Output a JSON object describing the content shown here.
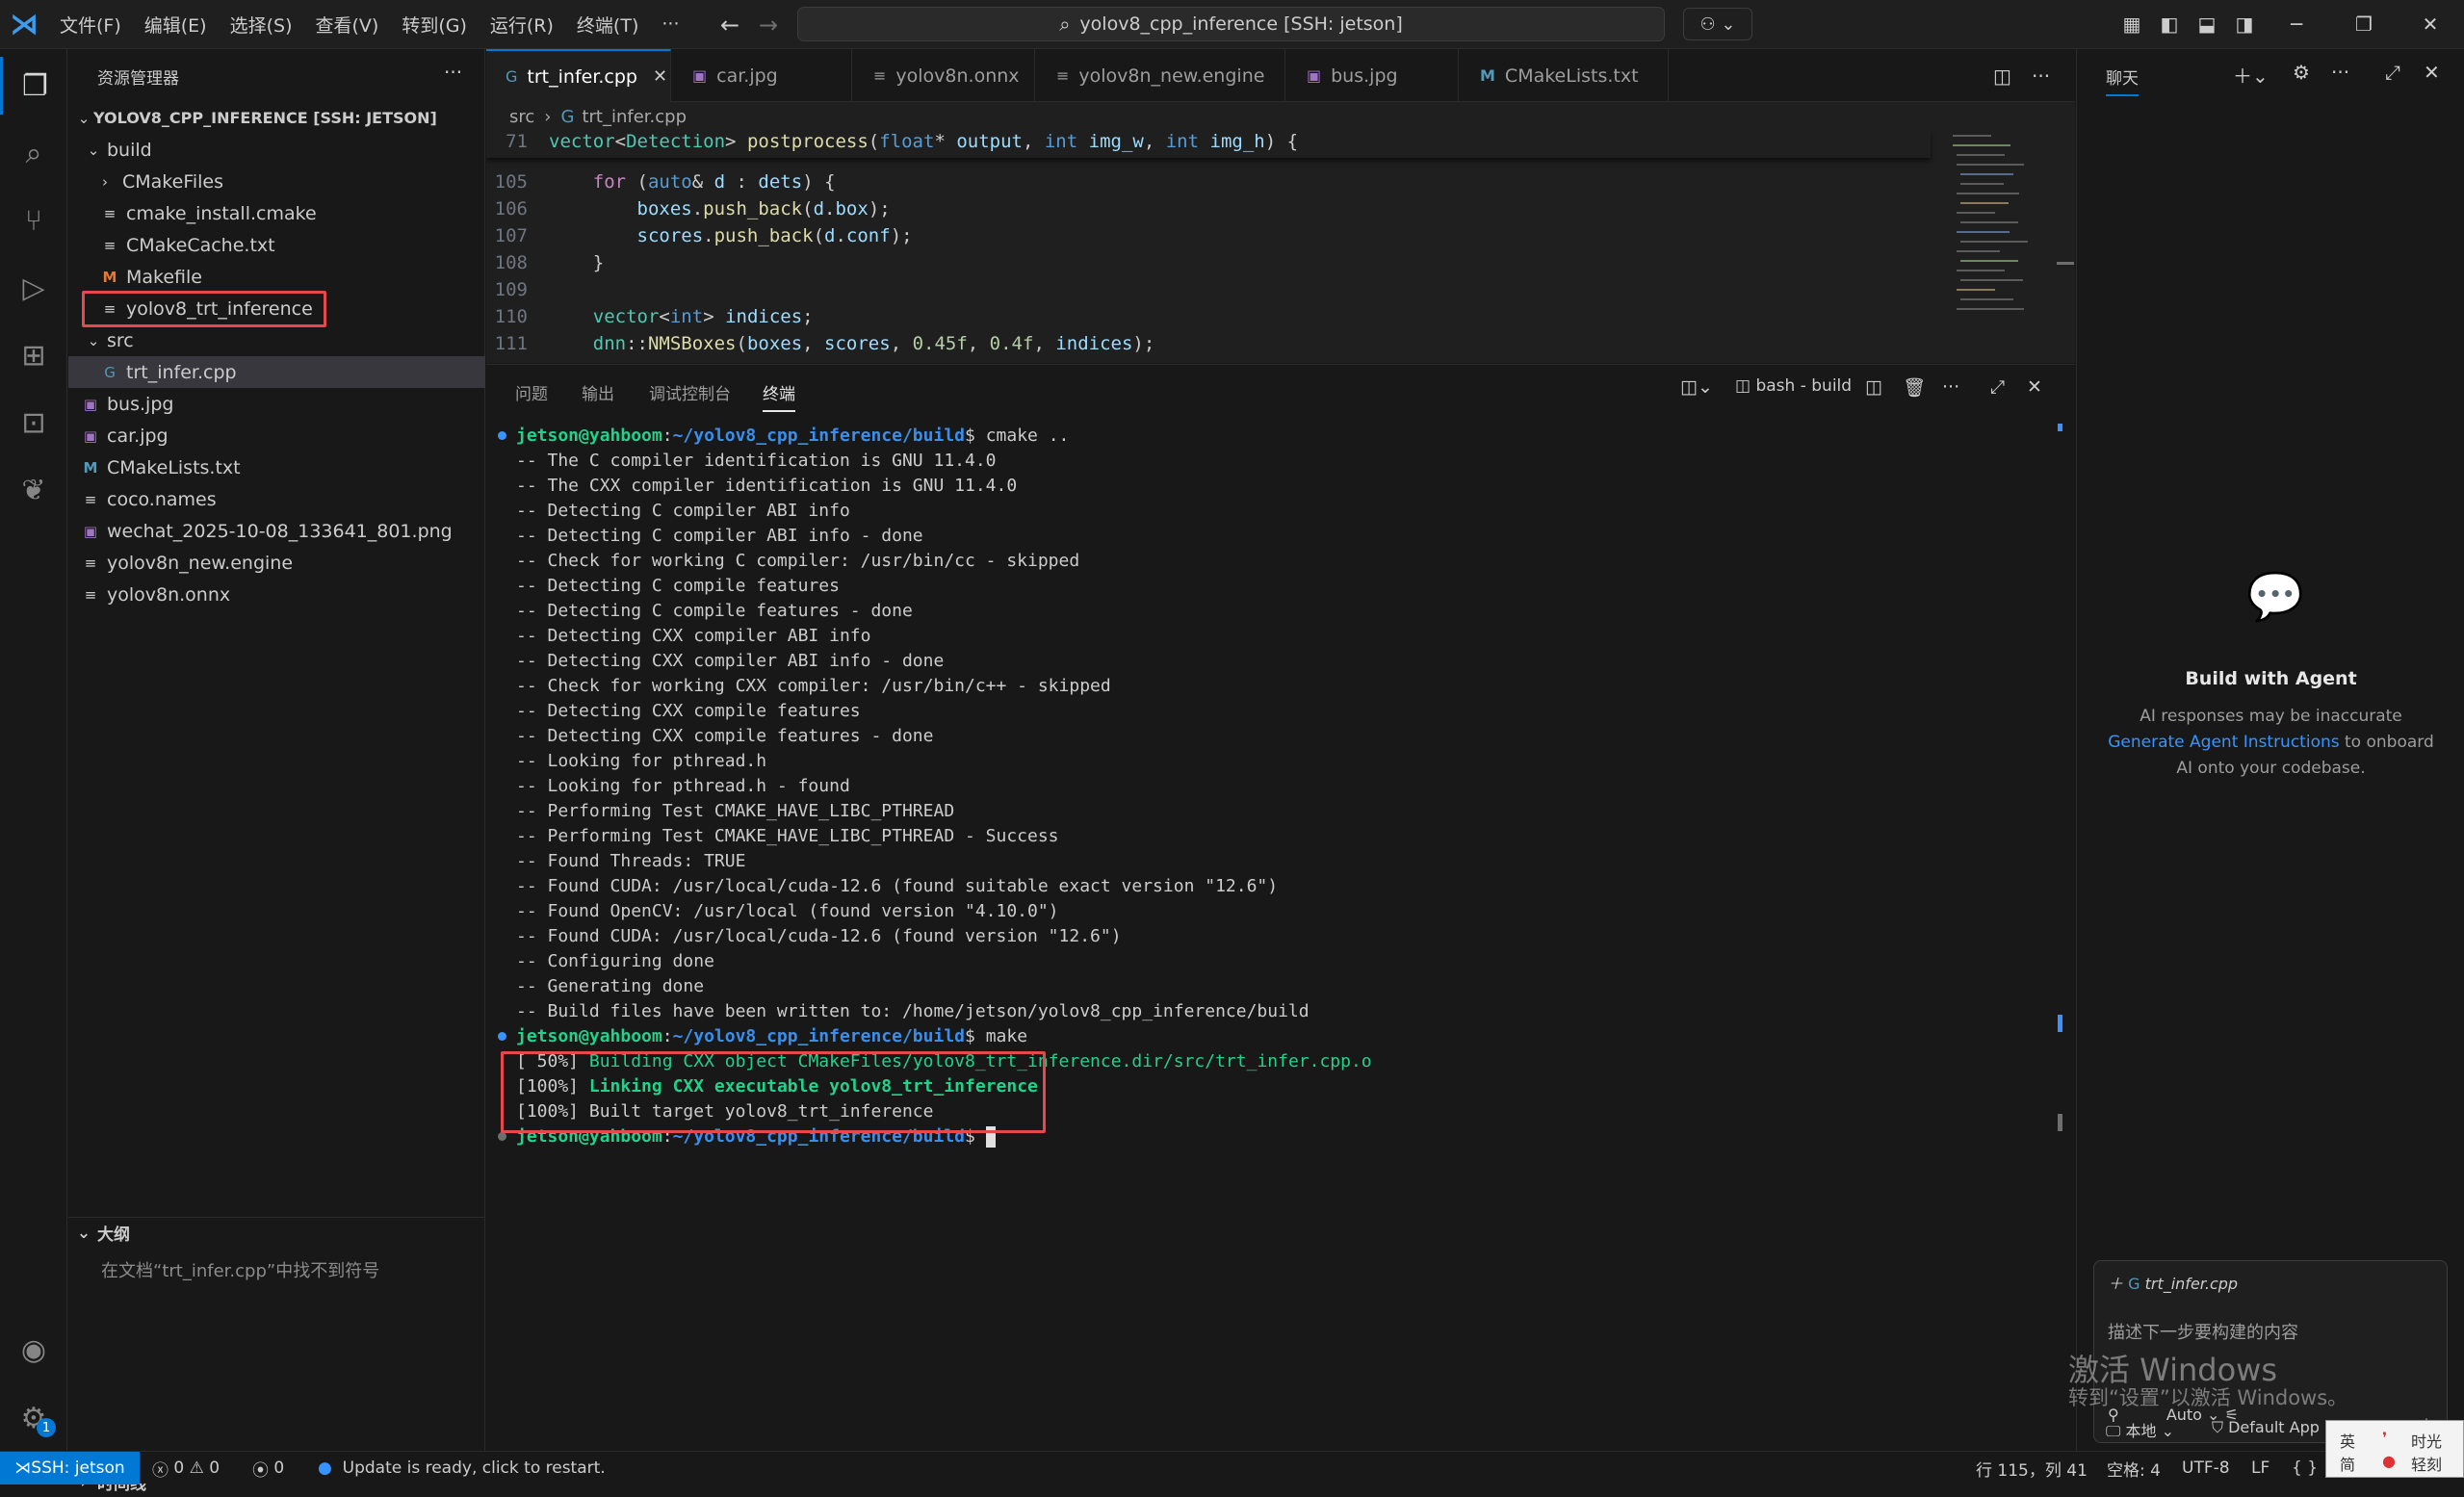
{
  "titlebar": {
    "menus": [
      "文件(F)",
      "编辑(E)",
      "选择(S)",
      "查看(V)",
      "转到(G)",
      "运行(R)",
      "终端(T)",
      "···"
    ],
    "search_text": "yolov8_cpp_inference [SSH: jetson]"
  },
  "explorer": {
    "header": "资源管理器",
    "project": "YOLOV8_CPP_INFERENCE [SSH: JETSON]",
    "items": [
      {
        "label": "build",
        "kind": "folder-open"
      },
      {
        "label": "CMakeFiles",
        "kind": "folder"
      },
      {
        "label": "cmake_install.cmake",
        "kind": "file"
      },
      {
        "label": "CMakeCache.txt",
        "kind": "file"
      },
      {
        "label": "Makefile",
        "kind": "make"
      },
      {
        "label": "yolov8_trt_inference",
        "kind": "file"
      },
      {
        "label": "src",
        "kind": "folder-open"
      },
      {
        "label": "trt_infer.cpp",
        "kind": "cpp"
      },
      {
        "label": "bus.jpg",
        "kind": "image"
      },
      {
        "label": "car.jpg",
        "kind": "image"
      },
      {
        "label": "CMakeLists.txt",
        "kind": "cmake"
      },
      {
        "label": "coco.names",
        "kind": "file"
      },
      {
        "label": "wechat_2025-10-08_133641_801.png",
        "kind": "image"
      },
      {
        "label": "yolov8n_new.engine",
        "kind": "file"
      },
      {
        "label": "yolov8n.onnx",
        "kind": "file"
      }
    ],
    "outline_title": "大纲",
    "outline_message": "在文档“trt_infer.cpp”中找不到符号",
    "timeline_title": "时间线"
  },
  "tabs": [
    "trt_infer.cpp",
    "car.jpg",
    "yolov8n.onnx",
    "yolov8n_new.engine",
    "bus.jpg",
    "CMakeLists.txt"
  ],
  "breadcrumb": {
    "folder": "src",
    "file": "trt_infer.cpp"
  },
  "code": {
    "sticky_num": "71",
    "line_nums": [
      "105",
      "106",
      "107",
      "108",
      "109",
      "110",
      "111"
    ],
    "sticky": {
      "t1": "vector",
      "t2": "Detection",
      "fn": "postprocess",
      "t3": "float",
      "p1": "output",
      "t4": "int",
      "p2": "img_w",
      "t5": "int",
      "p3": "img_h"
    },
    "l105": {
      "kw": "for",
      "t": "auto",
      "v": "d",
      "v2": "dets"
    },
    "l106": {
      "v": "boxes",
      "fn": "push_back",
      "v2": "d",
      "v3": "box"
    },
    "l107": {
      "v": "scores",
      "fn": "push_back",
      "v2": "d",
      "v3": "conf"
    },
    "l110": {
      "t1": "vector",
      "t2": "int",
      "v": "indices"
    },
    "l111": {
      "ns": "dnn",
      "fn": "NMSBoxes",
      "v1": "boxes",
      "v2": "scores",
      "n1": "0.45f",
      "n2": "0.4f",
      "v3": "indices"
    }
  },
  "panel": {
    "tabs": [
      "问题",
      "输出",
      "调试控制台",
      "终端"
    ],
    "terminal_name": "bash - build",
    "prompt_user": "jetson@yahboom",
    "prompt_path": "~/yolov8_cpp_inference/build",
    "cmd1": "cmake ..",
    "cmake_output": [
      "-- The C compiler identification is GNU 11.4.0",
      "-- The CXX compiler identification is GNU 11.4.0",
      "-- Detecting C compiler ABI info",
      "-- Detecting C compiler ABI info - done",
      "-- Check for working C compiler: /usr/bin/cc - skipped",
      "-- Detecting C compile features",
      "-- Detecting C compile features - done",
      "-- Detecting CXX compiler ABI info",
      "-- Detecting CXX compiler ABI info - done",
      "-- Check for working CXX compiler: /usr/bin/c++ - skipped",
      "-- Detecting CXX compile features",
      "-- Detecting CXX compile features - done",
      "-- Looking for pthread.h",
      "-- Looking for pthread.h - found",
      "-- Performing Test CMAKE_HAVE_LIBC_PTHREAD",
      "-- Performing Test CMAKE_HAVE_LIBC_PTHREAD - Success",
      "-- Found Threads: TRUE",
      "-- Found CUDA: /usr/local/cuda-12.6 (found suitable exact version \"12.6\")",
      "-- Found OpenCV: /usr/local (found version \"4.10.0\")",
      "-- Found CUDA: /usr/local/cuda-12.6 (found version \"12.6\")",
      "-- Configuring done",
      "-- Generating done",
      "-- Build files have been written to: /home/jetson/yolov8_cpp_inference/build"
    ],
    "cmd2": "make",
    "make1_pct": "[ 50%]",
    "make1_text": "Building CXX object CMakeFiles/yolov8_trt_inference.dir/src/trt_infer.cpp.o",
    "make2_pct": "[100%]",
    "make2_text": "Linking CXX executable yolov8_trt_inference",
    "make3": "[100%] Built target yolov8_trt_inference"
  },
  "chat": {
    "title": "聊天",
    "agent_title": "Build with Agent",
    "agent_line1": "AI responses may be inaccurate",
    "agent_link": "Generate Agent Instructions",
    "agent_line2_rest": "to onboard",
    "agent_line3": "AI onto your codebase.",
    "input_file": "trt_infer.cpp",
    "input_placeholder": "描述下一步要构建的内容",
    "mode": "Auto",
    "footer_left": "本地",
    "footer_right": "Default App"
  },
  "watermark": {
    "line1": "激活 Windows",
    "line2": "转到“设置”以激活 Windows。"
  },
  "ime": {
    "a": "英",
    "b": "简",
    "c": "时光",
    "d": "轻刻"
  },
  "statusbar": {
    "remote": "SSH: jetson",
    "errors": "0",
    "warnings": "0",
    "ports": "0",
    "update": "Update is ready, click to restart.",
    "position": "行 115，列 41",
    "spaces": "空格: 4",
    "encoding": "UTF-8",
    "eol": "LF",
    "lang": "{ }"
  }
}
